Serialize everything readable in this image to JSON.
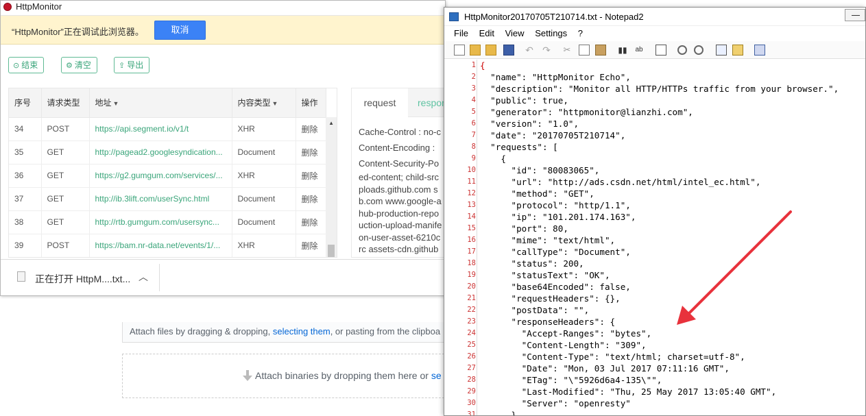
{
  "background_page": {
    "attach_text_pre": "Attach files by dragging & dropping, ",
    "attach_link": "selecting them",
    "attach_text_post": ", or pasting from the clipboa",
    "binary_text_pre": "Attach binaries by dropping them here or ",
    "binary_link": "se"
  },
  "httpmonitor": {
    "title": "HttpMonitor",
    "debug_message": "“HttpMonitor”正在调试此浏览器。",
    "cancel_label": "取消",
    "toolbar": {
      "end_label": "结束",
      "clear_label": "清空",
      "export_label": "导出"
    },
    "table": {
      "headers": {
        "index": "序号",
        "method": "请求类型",
        "url": "地址",
        "content_type": "内容类型",
        "action": "操作"
      },
      "rows": [
        {
          "index": "34",
          "method": "POST",
          "url": "https://api.segment.io/v1/t",
          "content_type": "XHR",
          "action": "删除"
        },
        {
          "index": "35",
          "method": "GET",
          "url": "http://pagead2.googlesyndication...",
          "content_type": "Document",
          "action": "删除"
        },
        {
          "index": "36",
          "method": "GET",
          "url": "https://g2.gumgum.com/services/...",
          "content_type": "XHR",
          "action": "删除"
        },
        {
          "index": "37",
          "method": "GET",
          "url": "http://ib.3lift.com/userSync.html",
          "content_type": "Document",
          "action": "删除"
        },
        {
          "index": "38",
          "method": "GET",
          "url": "http://rtb.gumgum.com/usersync...",
          "content_type": "Document",
          "action": "删除"
        },
        {
          "index": "39",
          "method": "POST",
          "url": "https://bam.nr-data.net/events/1/...",
          "content_type": "XHR",
          "action": "删除"
        }
      ]
    },
    "detail": {
      "tab_request": "request",
      "tab_response": "respon",
      "header_lines": [
        "Cache-Control : no-c",
        "Content-Encoding :",
        "Content-Security-Po"
      ],
      "csp_lines": [
        "ed-content; child-src",
        "ploads.github.com s",
        "b.com www.google-a",
        "hub-production-repo",
        "uction-upload-manife",
        "on-user-asset-6210c",
        "rc assets-cdn.github"
      ]
    },
    "download": {
      "text": "正在打开 HttpM....txt..."
    }
  },
  "notepad": {
    "title": "HttpMonitor20170705T210714.txt - Notepad2",
    "menu": [
      "File",
      "Edit",
      "View",
      "Settings",
      "?"
    ],
    "lines": [
      "{",
      "  \"name\": \"HttpMonitor Echo\",",
      "  \"description\": \"Monitor all HTTP/HTTPs traffic from your browser.\",",
      "  \"public\": true,",
      "  \"generator\": \"httpmonitor@lianzhi.com\",",
      "  \"version\": \"1.0\",",
      "  \"date\": \"20170705T210714\",",
      "  \"requests\": [",
      "    {",
      "      \"id\": \"80083065\",",
      "      \"url\": \"http://ads.csdn.net/html/intel_ec.html\",",
      "      \"method\": \"GET\",",
      "      \"protocol\": \"http/1.1\",",
      "      \"ip\": \"101.201.174.163\",",
      "      \"port\": 80,",
      "      \"mime\": \"text/html\",",
      "      \"callType\": \"Document\",",
      "      \"status\": 200,",
      "      \"statusText\": \"OK\",",
      "      \"base64Encoded\": false,",
      "      \"requestHeaders\": {},",
      "      \"postData\": \"\",",
      "      \"responseHeaders\": {",
      "        \"Accept-Ranges\": \"bytes\",",
      "        \"Content-Length\": \"309\",",
      "        \"Content-Type\": \"text/html; charset=utf-8\",",
      "        \"Date\": \"Mon, 03 Jul 2017 07:11:16 GMT\",",
      "        \"ETag\": \"\\\"5926d6a4-135\\\"\",",
      "        \"Last-Modified\": \"Thu, 25 May 2017 13:05:40 GMT\",",
      "        \"Server\": \"openresty\"",
      "      },"
    ]
  },
  "annotation": {
    "arrow_color": "#e8323c"
  }
}
